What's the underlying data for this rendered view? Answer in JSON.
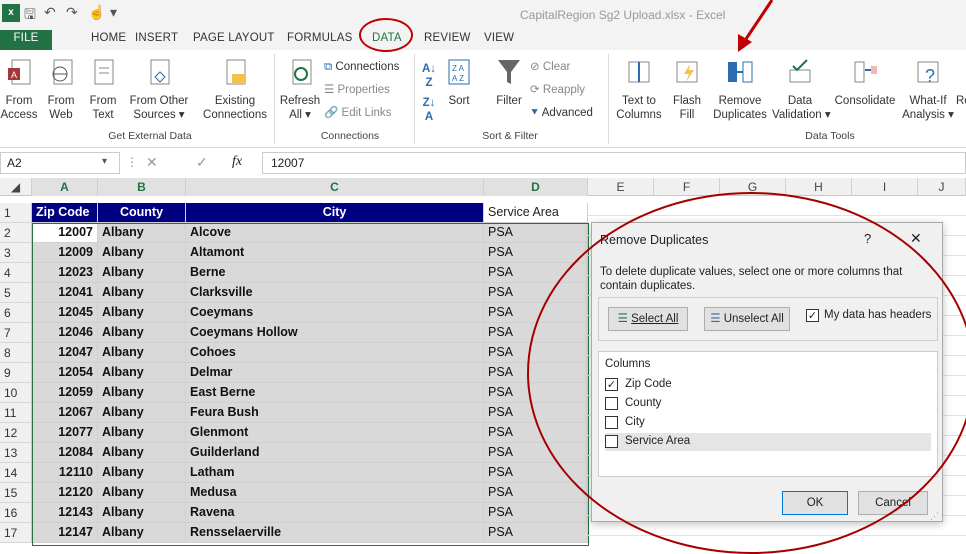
{
  "window": {
    "title": "CapitalRegion Sg2 Upload.xlsx - Excel"
  },
  "tabs": [
    "FILE",
    "HOME",
    "INSERT",
    "PAGE LAYOUT",
    "FORMULAS",
    "DATA",
    "REVIEW",
    "VIEW"
  ],
  "ribbon": {
    "get_external": {
      "from_access": [
        "From",
        "Access"
      ],
      "from_web": [
        "From",
        "Web"
      ],
      "from_text": [
        "From",
        "Text"
      ],
      "from_other": [
        "From Other",
        "Sources ▾"
      ],
      "existing": [
        "Existing",
        "Connections"
      ],
      "group": "Get External Data"
    },
    "connections": {
      "refresh": [
        "Refresh",
        "All ▾"
      ],
      "connections": "Connections",
      "properties": "Properties",
      "edit_links": "Edit Links",
      "group": "Connections"
    },
    "sort_filter": {
      "sort": "Sort",
      "filter": "Filter",
      "clear": "Clear",
      "reapply": "Reapply",
      "advanced": "Advanced",
      "group": "Sort & Filter"
    },
    "data_tools": {
      "text_to_columns": [
        "Text to",
        "Columns"
      ],
      "flash_fill": [
        "Flash",
        "Fill"
      ],
      "remove_duplicates": [
        "Remove",
        "Duplicates"
      ],
      "data_validation": [
        "Data",
        "Validation ▾"
      ],
      "consolidate": "Consolidate",
      "what_if": [
        "What-If",
        "Analysis ▾"
      ],
      "re": "Re",
      "group": "Data Tools"
    }
  },
  "formula_bar": {
    "name_box": "A2",
    "cancel": "✕",
    "enter": "✓",
    "fx": "fx",
    "value": "12007"
  },
  "columns": [
    "A",
    "B",
    "C",
    "D",
    "E",
    "F",
    "G",
    "H",
    "I",
    "J"
  ],
  "header_row": [
    "Zip Code",
    "County",
    "City",
    "Service Area"
  ],
  "rows": [
    [
      "12007",
      "Albany",
      "Alcove",
      "PSA"
    ],
    [
      "12009",
      "Albany",
      "Altamont",
      "PSA"
    ],
    [
      "12023",
      "Albany",
      "Berne",
      "PSA"
    ],
    [
      "12041",
      "Albany",
      "Clarksville",
      "PSA"
    ],
    [
      "12045",
      "Albany",
      "Coeymans",
      "PSA"
    ],
    [
      "12046",
      "Albany",
      "Coeymans Hollow",
      "PSA"
    ],
    [
      "12047",
      "Albany",
      "Cohoes",
      "PSA"
    ],
    [
      "12054",
      "Albany",
      "Delmar",
      "PSA"
    ],
    [
      "12059",
      "Albany",
      "East Berne",
      "PSA"
    ],
    [
      "12067",
      "Albany",
      "Feura Bush",
      "PSA"
    ],
    [
      "12077",
      "Albany",
      "Glenmont",
      "PSA"
    ],
    [
      "12084",
      "Albany",
      "Guilderland",
      "PSA"
    ],
    [
      "12110",
      "Albany",
      "Latham",
      "PSA"
    ],
    [
      "12120",
      "Albany",
      "Medusa",
      "PSA"
    ],
    [
      "12143",
      "Albany",
      "Ravena",
      "PSA"
    ],
    [
      "12147",
      "Albany",
      "Rensselaerville",
      "PSA"
    ]
  ],
  "row_numbers": [
    "1",
    "2",
    "3",
    "4",
    "5",
    "6",
    "7",
    "8",
    "9",
    "10",
    "11",
    "12",
    "13",
    "14",
    "15",
    "16",
    "17"
  ],
  "dialog": {
    "title": "Remove Duplicates",
    "help": "?",
    "close": "✕",
    "description": "To delete duplicate values, select one or more columns that contain duplicates.",
    "select_all": "Select All",
    "unselect_all": "Unselect All",
    "my_data_headers": "My data has headers",
    "columns_label": "Columns",
    "columns": [
      {
        "label": "Zip Code",
        "checked": true
      },
      {
        "label": "County",
        "checked": false
      },
      {
        "label": "City",
        "checked": false
      },
      {
        "label": "Service Area",
        "checked": false
      }
    ],
    "ok": "OK",
    "cancel": "Cancel"
  },
  "colors": {
    "excel_green": "#217346",
    "header_fill": "#000080",
    "selection_fill": "#d9d9d9",
    "annotation_red": "#c00000"
  }
}
